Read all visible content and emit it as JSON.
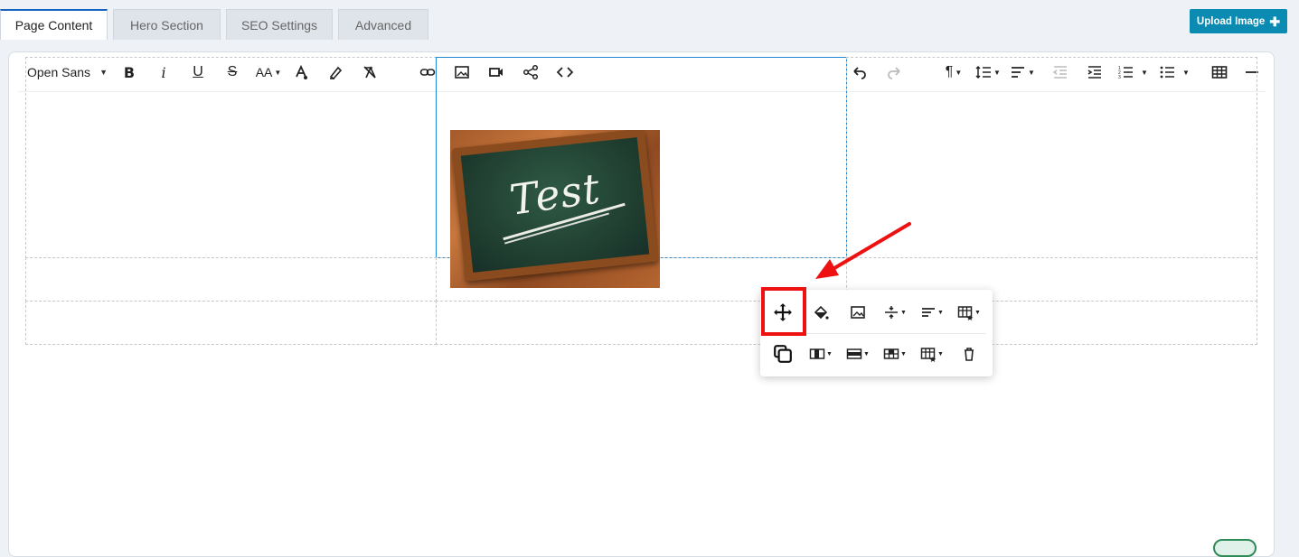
{
  "tabs": [
    {
      "label": "Page Content",
      "active": true
    },
    {
      "label": "Hero Section",
      "active": false
    },
    {
      "label": "SEO Settings",
      "active": false
    },
    {
      "label": "Advanced",
      "active": false
    }
  ],
  "upload_button": {
    "label": "Upload Image",
    "icon": "plus-icon",
    "color": "#0b8bb2"
  },
  "toolbar": {
    "font_family": "Open Sans",
    "font_size_label": "AA",
    "buttons": [
      "bold",
      "italic",
      "underline",
      "strikethrough",
      "font-size",
      "text-color",
      "highlight",
      "clear-formatting",
      "insert-link",
      "insert-image",
      "insert-video",
      "share",
      "code-view",
      "undo",
      "redo",
      "paragraph-format",
      "line-height",
      "align",
      "outdent",
      "indent",
      "ordered-list",
      "unordered-list",
      "insert-table",
      "horizontal-line"
    ]
  },
  "content": {
    "image_text": "Test"
  },
  "popup": {
    "row1": [
      "move-icon",
      "cell-background-icon",
      "replace-image-icon",
      "vertical-align-icon",
      "horizontal-align-icon",
      "table-style-icon"
    ],
    "row2": [
      "copy-icon",
      "column-icon",
      "row-icon",
      "cell-icon",
      "cell-style-icon",
      "remove-table-icon"
    ]
  },
  "annotation_color": "#ee1111"
}
